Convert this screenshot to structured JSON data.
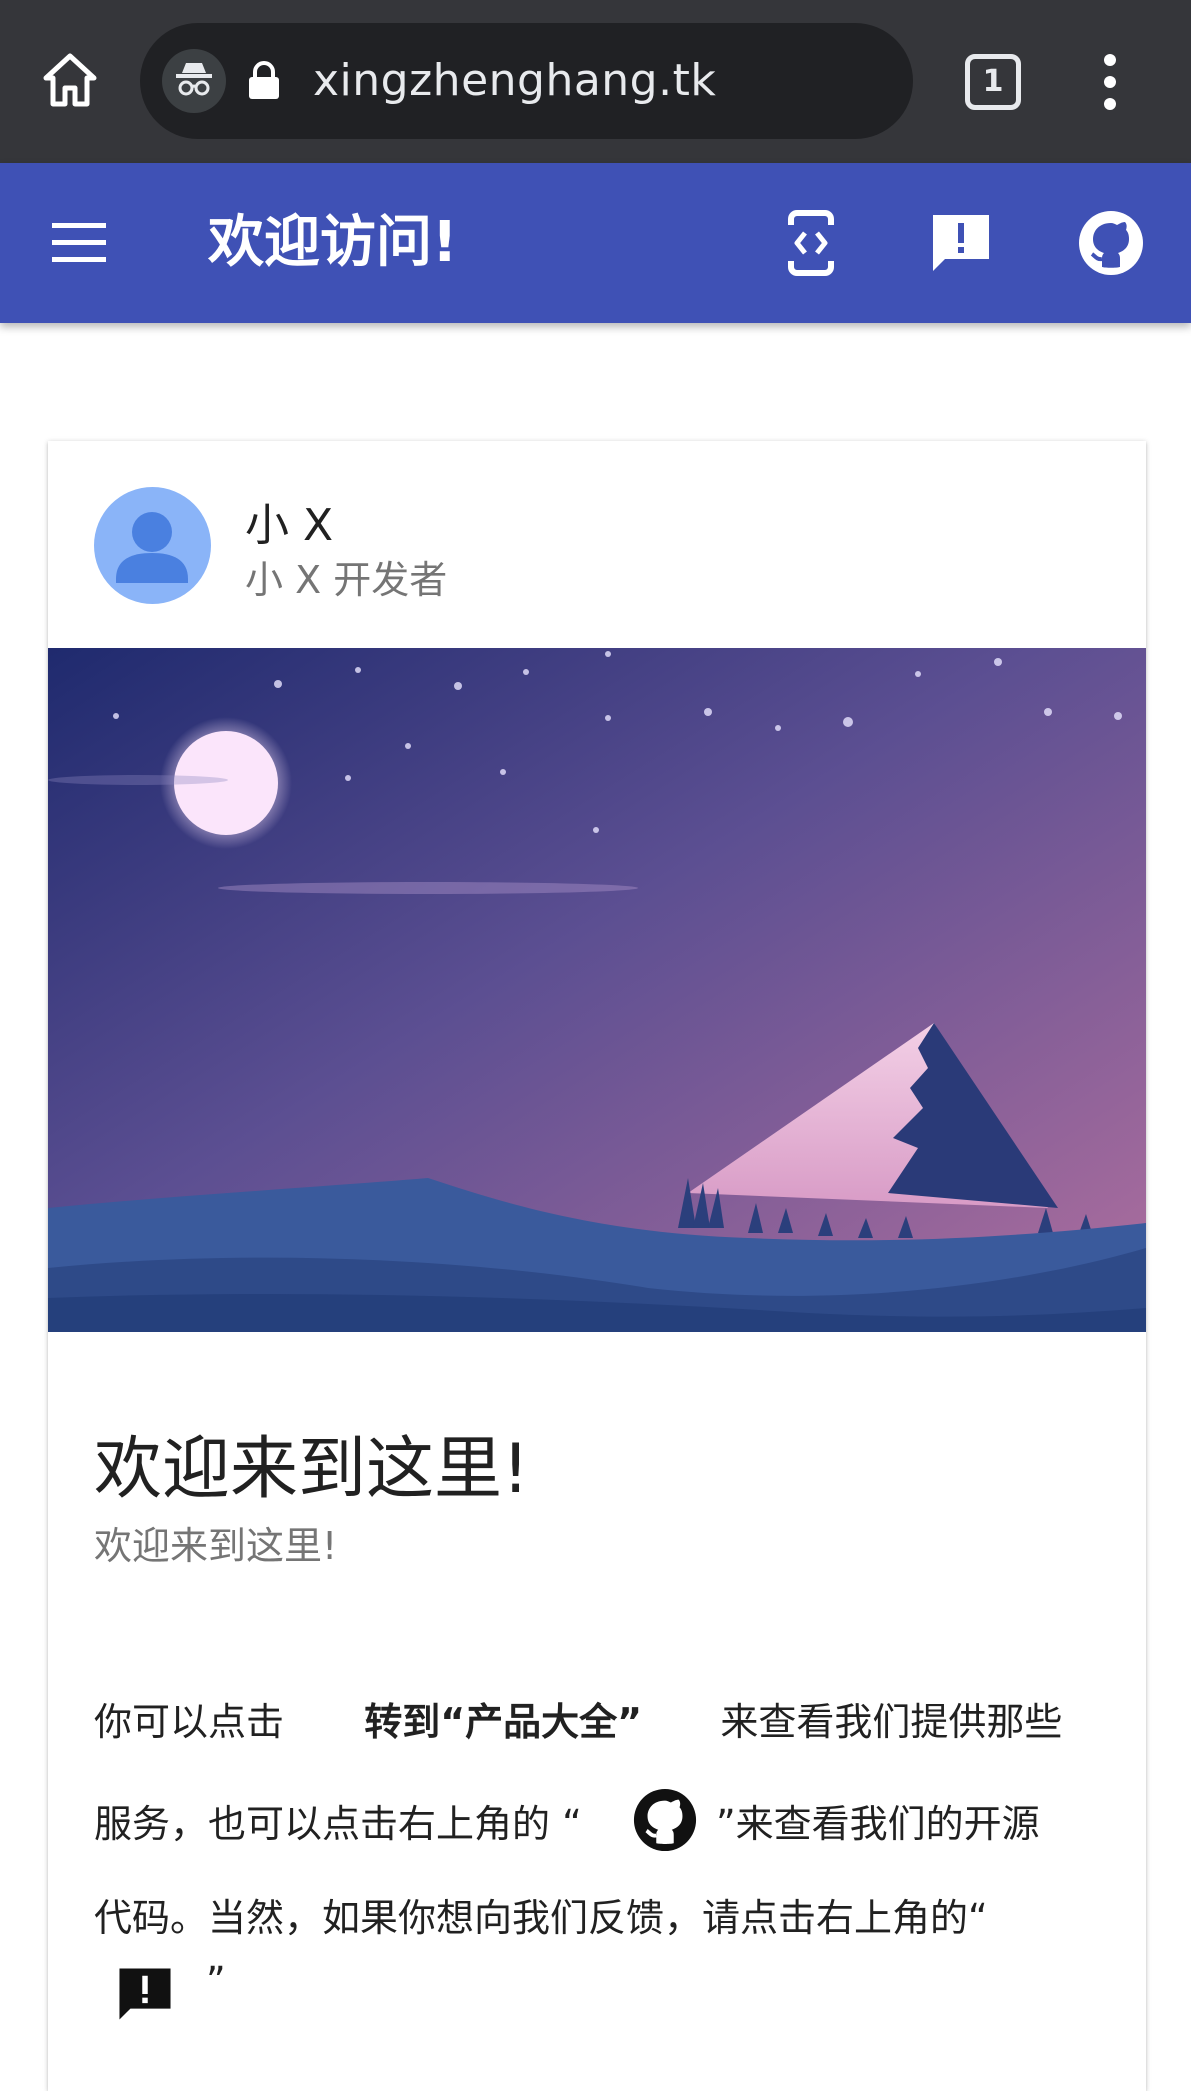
{
  "browser": {
    "url": "xingzhenghang.tk",
    "tab_count": "1",
    "icons": [
      "home-icon",
      "incognito-icon",
      "lock-icon",
      "tab-switcher-icon",
      "more-vert-icon"
    ]
  },
  "appbar": {
    "title": "欢迎访问!",
    "color": "#3f51b5",
    "actions": [
      "code-icon",
      "feedback-icon",
      "github-icon"
    ]
  },
  "card": {
    "author_name": "小 X",
    "author_role": "小 X 开发者",
    "headline": "欢迎来到这里!",
    "subhead": "欢迎来到这里!",
    "body": {
      "line1_part1": "你可以点击",
      "line1_link": "转到“产品大全”",
      "line1_part2": "来查看我们提供那些",
      "line2_part1": "服务，也可以点击右上角的 “",
      "line2_part2": "”来查看我们的开源",
      "line3": "代码。当然，如果你想向我们反馈，请点击右上角的“",
      "line4_part2": "”"
    }
  }
}
